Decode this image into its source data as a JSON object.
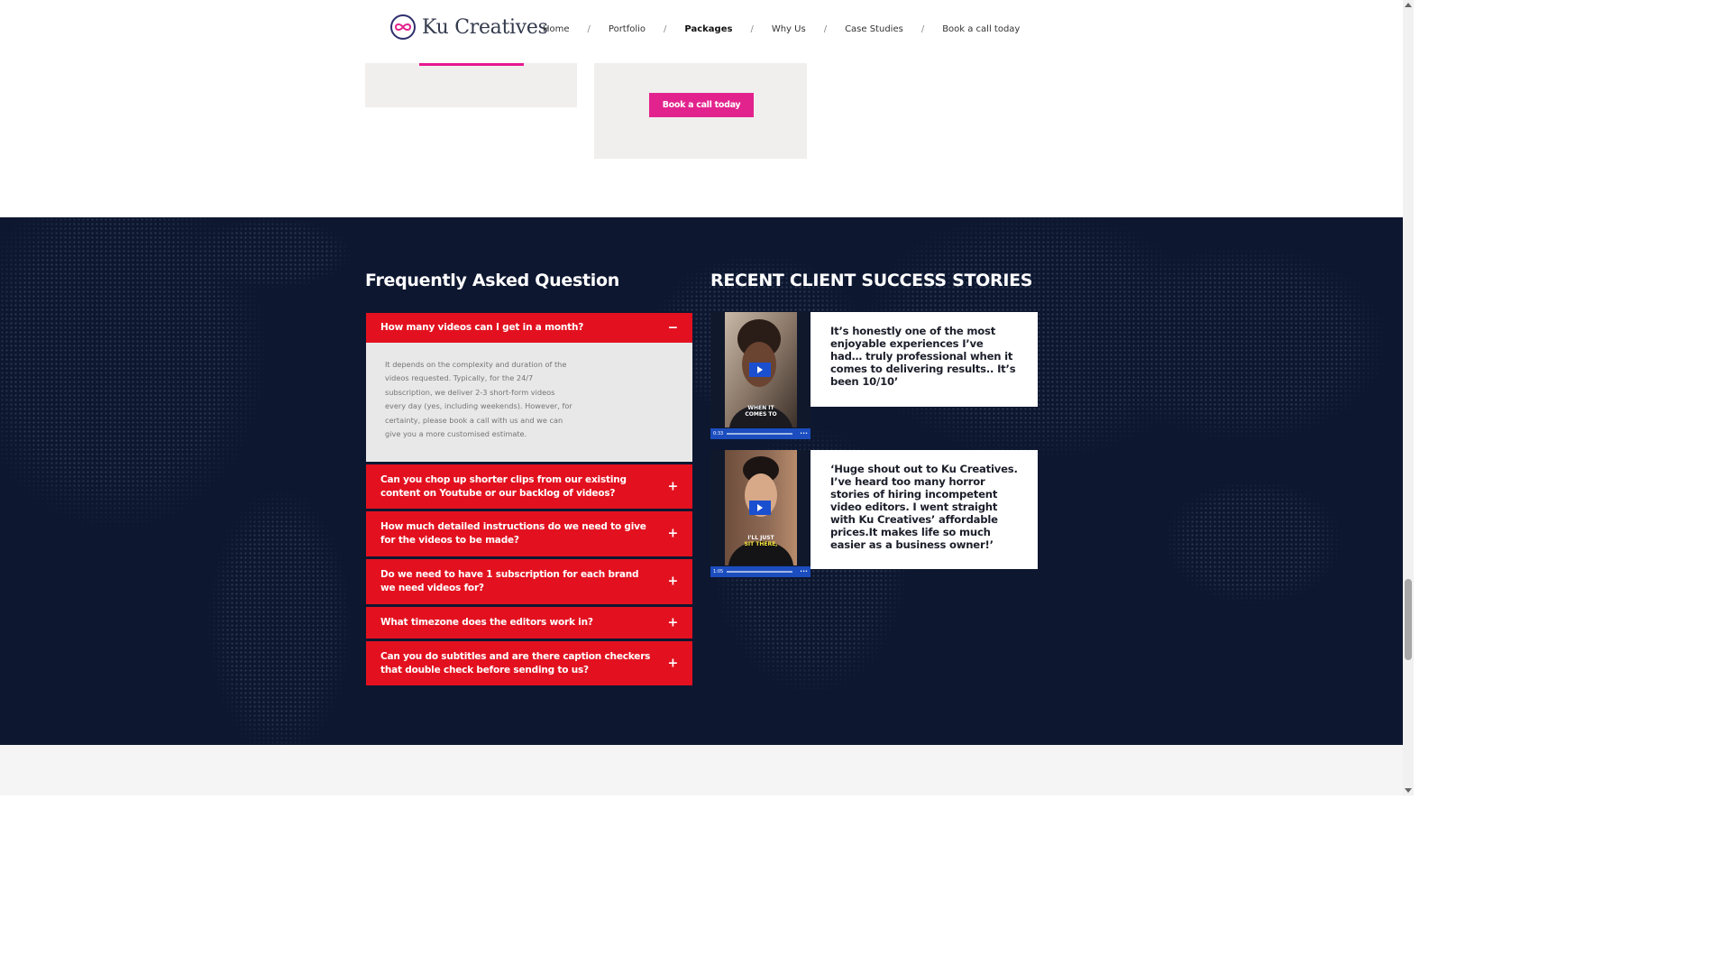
{
  "brand": {
    "name": "Ku Creatives",
    "logo_icon": "infinity-circle-icon",
    "accent": "#e3238d"
  },
  "nav": {
    "items": [
      {
        "label": "Home",
        "active": false
      },
      {
        "label": "Portfolio",
        "active": false
      },
      {
        "label": "Packages",
        "active": true
      },
      {
        "label": "Why Us",
        "active": false
      },
      {
        "label": "Case Studies",
        "active": false
      },
      {
        "label": "Book a call today",
        "active": false
      }
    ],
    "separator": "/"
  },
  "packages": {
    "book_button_label": "Book a call today"
  },
  "faq": {
    "title": "Frequently Asked Question",
    "color": "#e3111f",
    "items": [
      {
        "question": "How many videos can I get in a month?",
        "expanded": true,
        "icon": "minus-icon",
        "icon_glyph": "−",
        "answer": "It depends on the complexity and duration of the videos requested. Typically, for the 24/7 subscription, we deliver 2-3 short-form videos every day (yes, including weekends). However, for certainty, please book a call with us and we can give you a more customised estimate."
      },
      {
        "question": "Can you chop up shorter clips from our existing content on Youtube or our backlog of videos?",
        "expanded": false,
        "icon": "plus-icon",
        "icon_glyph": "+"
      },
      {
        "question": "How much detailed instructions do we need to give for the videos to be made?",
        "expanded": false,
        "icon": "plus-icon",
        "icon_glyph": "+"
      },
      {
        "question": "Do we need to have 1 subscription for each brand we need videos for?",
        "expanded": false,
        "icon": "plus-icon",
        "icon_glyph": "+"
      },
      {
        "question": "What timezone does the editors work in?",
        "expanded": false,
        "icon": "plus-icon",
        "icon_glyph": "+"
      },
      {
        "question": "Can you do subtitles and are there caption checkers that double check before sending to us?",
        "expanded": false,
        "icon": "plus-icon",
        "icon_glyph": "+"
      }
    ]
  },
  "stories": {
    "title": "RECENT CLIENT SUCCESS STORIES",
    "items": [
      {
        "video_time": "0:33",
        "caption_line1": "WHEN IT",
        "caption_line2": "COMES TO",
        "quote": "It’s honestly one of the most enjoyable experiences I’ve had… truly professional when it comes to delivering results.. It’s been 10/10’"
      },
      {
        "video_time": "1:05",
        "caption_line1": "I'LL JUST",
        "caption_line2": "SIT THERE,",
        "quote": "‘Huge shout out to Ku Creatives. I’ve heard too many horror stories of hiring incompetent video editors. I went straight with Ku Creatives’ affordable prices.It makes life so much easier as a business owner!’"
      }
    ],
    "more_icon": "ellipsis-icon",
    "play_icon": "play-icon"
  }
}
